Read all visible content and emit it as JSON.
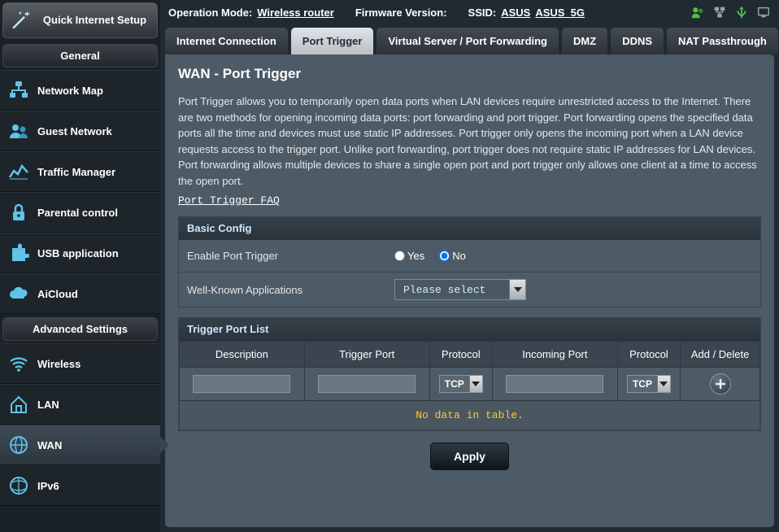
{
  "topbar": {
    "opmode_label": "Operation Mode:",
    "opmode_value": "Wireless router",
    "fw_label": "Firmware Version:",
    "ssid_label": "SSID:",
    "ssid_1": "ASUS",
    "ssid_2": "ASUS_5G"
  },
  "quick_setup": {
    "line": "Quick Internet Setup"
  },
  "section_general": "General",
  "nav_general": [
    {
      "key": "network-map",
      "label": "Network Map"
    },
    {
      "key": "guest-network",
      "label": "Guest Network"
    },
    {
      "key": "traffic-manager",
      "label": "Traffic Manager"
    },
    {
      "key": "parental-control",
      "label": "Parental control"
    },
    {
      "key": "usb-application",
      "label": "USB application"
    },
    {
      "key": "aicloud",
      "label": "AiCloud"
    }
  ],
  "section_advanced": "Advanced Settings",
  "nav_advanced": [
    {
      "key": "wireless",
      "label": "Wireless"
    },
    {
      "key": "lan",
      "label": "LAN"
    },
    {
      "key": "wan",
      "label": "WAN",
      "active": true
    },
    {
      "key": "ipv6",
      "label": "IPv6"
    }
  ],
  "tabs": [
    {
      "key": "internet-connection",
      "label": "Internet Connection"
    },
    {
      "key": "port-trigger",
      "label": "Port Trigger",
      "active": true
    },
    {
      "key": "virtual-server",
      "label": "Virtual Server / Port Forwarding"
    },
    {
      "key": "dmz",
      "label": "DMZ"
    },
    {
      "key": "ddns",
      "label": "DDNS"
    },
    {
      "key": "nat-passthrough",
      "label": "NAT Passthrough"
    }
  ],
  "page": {
    "title": "WAN - Port Trigger",
    "description": "Port Trigger allows you to temporarily open data ports when LAN devices require unrestricted access to the Internet. There are two methods for opening incoming data ports: port forwarding and port trigger. Port forwarding opens the specified data ports all the time and devices must use static IP addresses. Port trigger only opens the incoming port when a LAN device requests access to the trigger port. Unlike port forwarding, port trigger does not require static IP addresses for LAN devices. Port forwarding allows multiple devices to share a single open port and port trigger only allows one client at a time to access the open port.",
    "faq_link": "Port Trigger FAQ"
  },
  "basic_config": {
    "header": "Basic Config",
    "enable_label": "Enable Port Trigger",
    "yes": "Yes",
    "no": "No",
    "enable_value": "No",
    "apps_label": "Well-Known Applications",
    "apps_selected": "Please select"
  },
  "trigger_list": {
    "header": "Trigger Port List",
    "col_description": "Description",
    "col_trigger_port": "Trigger Port",
    "col_protocol": "Protocol",
    "col_incoming_port": "Incoming Port",
    "col_protocol2": "Protocol",
    "col_add_delete": "Add / Delete",
    "proto_default": "TCP",
    "no_data": "No data in table."
  },
  "apply_label": "Apply"
}
